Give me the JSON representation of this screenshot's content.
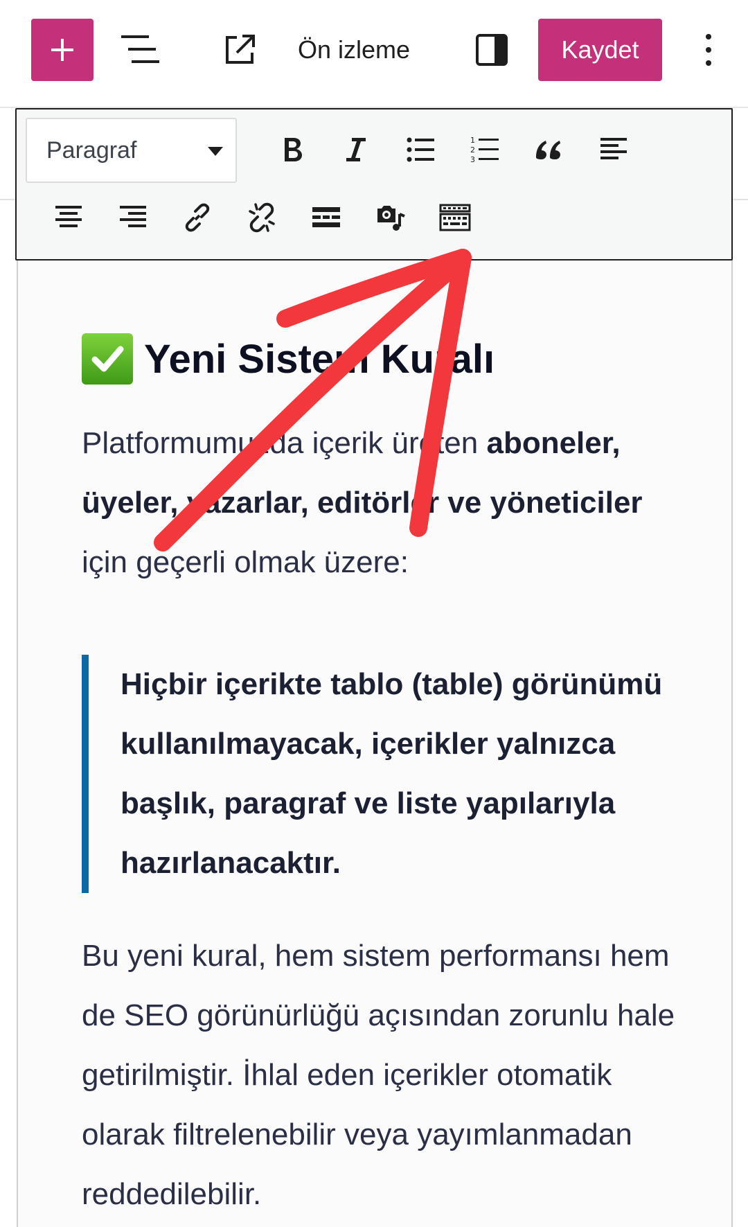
{
  "header": {
    "add_block_label": "Add block",
    "preview_label": "Ön izleme",
    "save_label": "Kaydet",
    "icons": [
      "plus-icon",
      "document-overview-icon",
      "external-link-icon",
      "sidebar-toggle-icon",
      "more-vertical-icon"
    ]
  },
  "toolbar": {
    "format_select": {
      "value": "Paragraf"
    },
    "row1_icons": [
      "bold-icon",
      "italic-icon",
      "bulleted-list-icon",
      "numbered-list-icon",
      "blockquote-icon",
      "align-left-icon"
    ],
    "row2_icons": [
      "align-center-icon",
      "align-right-icon",
      "link-icon",
      "unlink-icon",
      "read-more-icon",
      "add-media-icon",
      "toolbar-toggle-icon"
    ]
  },
  "content": {
    "heading": {
      "emoji": "check-mark-icon",
      "text": "Yeni Sistem Kuralı"
    },
    "paragraph1": {
      "part1": "Platformumuzda içerik üreten ",
      "bold": "aboneler, üyeler, yazarlar, editörler ve yöneticiler",
      "part2": " için geçerli olmak üzere:"
    },
    "quote": {
      "text": "Hiçbir içerikte tablo (table) görünümü kullanılmayacak, içerikler yalnızca başlık, paragraf ve liste yapılarıyla hazırlanacaktır."
    },
    "paragraph2": {
      "text": "Bu yeni kural, hem sistem performansı hem de SEO görünürlüğü açısından zorunlu hale getirilmiştir. İhlal eden içerikler otomatik olarak filtrelenebilir veya yayımlanmadan reddedilebilir."
    }
  },
  "colors": {
    "accent": "#c5307a",
    "quote_border": "#0a6aa6",
    "annotation_arrow": "#f2383c"
  }
}
